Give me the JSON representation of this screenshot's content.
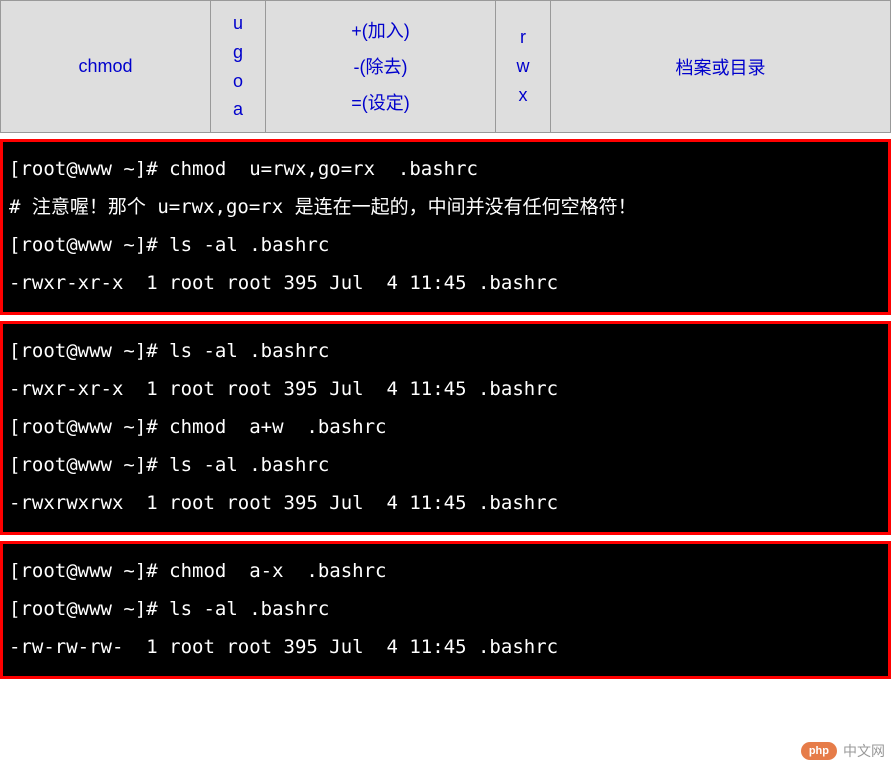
{
  "table": {
    "col1": "chmod",
    "col2": [
      "u",
      "g",
      "o",
      "a"
    ],
    "col3": [
      "+(加入)",
      "-(除去)",
      "=(设定)"
    ],
    "col4": [
      "r",
      "w",
      "x"
    ],
    "col5": "档案或目录"
  },
  "terminals": [
    {
      "lines": [
        "[root@www ~]# chmod  u=rwx,go=rx  .bashrc",
        "# 注意喔！那个 u=rwx,go=rx 是连在一起的，中间并没有任何空格符！",
        "[root@www ~]# ls -al .bashrc",
        "-rwxr-xr-x  1 root root 395 Jul  4 11:45 .bashrc"
      ]
    },
    {
      "lines": [
        "[root@www ~]# ls -al .bashrc",
        "-rwxr-xr-x  1 root root 395 Jul  4 11:45 .bashrc",
        "[root@www ~]# chmod  a+w  .bashrc",
        "[root@www ~]# ls -al .bashrc",
        "-rwxrwxrwx  1 root root 395 Jul  4 11:45 .bashrc"
      ]
    },
    {
      "lines": [
        "[root@www ~]# chmod  a-x  .bashrc",
        "[root@www ~]# ls -al .bashrc",
        "-rw-rw-rw-  1 root root 395 Jul  4 11:45 .bashrc"
      ]
    }
  ],
  "watermark": {
    "logo": "php",
    "text": "中文网"
  }
}
